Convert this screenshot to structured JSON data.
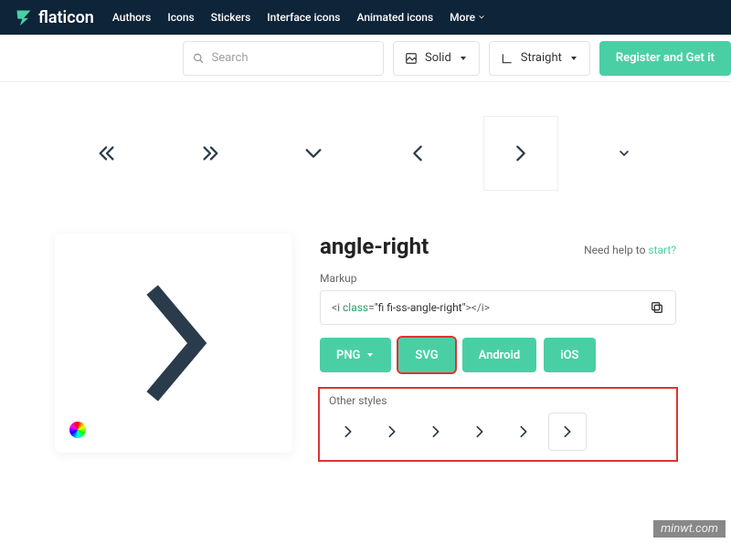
{
  "nav": {
    "brand": "flaticon",
    "links": [
      "Authors",
      "Icons",
      "Stickers",
      "Interface icons",
      "Animated icons"
    ],
    "more": "More"
  },
  "search": {
    "placeholder": "Search",
    "filter1": "Solid",
    "filter2": "Straight",
    "cta": "Register and Get it"
  },
  "icon": {
    "name": "angle-right",
    "help_prefix": "Need help to ",
    "help_link": "start?",
    "markup_label": "Markup",
    "markup": "<i class=\"fi fi-ss-angle-right\"></i>"
  },
  "downloads": {
    "png": "PNG",
    "svg": "SVG",
    "android": "Android",
    "ios": "iOS"
  },
  "other": {
    "label": "Other styles"
  },
  "watermark": "minwt.com"
}
